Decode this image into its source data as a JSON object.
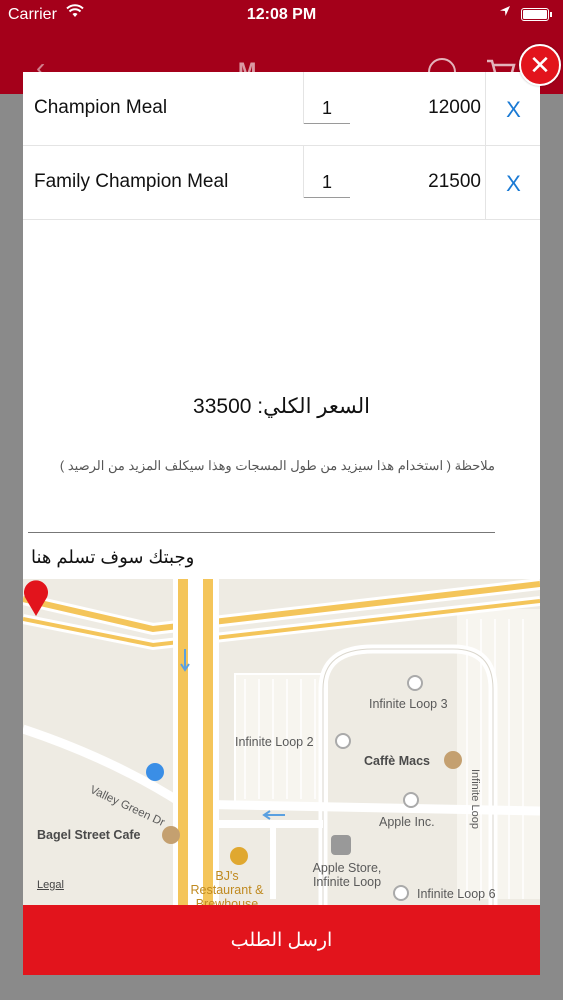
{
  "status_bar": {
    "carrier": "Carrier",
    "time": "12:08 PM"
  },
  "nav": {
    "title": "M..."
  },
  "order_items": [
    {
      "name": "Champion Meal",
      "qty": "1",
      "price": "12000",
      "remove": "X"
    },
    {
      "name": "Family Champion Meal",
      "qty": "1",
      "price": "21500",
      "remove": "X"
    }
  ],
  "total": {
    "label": "السعر الكلي:",
    "value": "33500"
  },
  "note": "ملاحظة ( استخدام هذا سيزيد من طول المسجات وهذا سيكلف المزيد من الرصيد )",
  "deliver_label": "وجبتك سوف تسلم هنا",
  "map": {
    "labels": {
      "infinite_loop_3": "Infinite Loop 3",
      "infinite_loop_2": "Infinite Loop 2",
      "caffe_macs": "Caffè Macs",
      "infinite_loop_road": "Infinite Loop",
      "valley_green": "Valley Green Dr",
      "apple_inc": "Apple Inc.",
      "bagel_street": "Bagel Street Cafe",
      "bjs": "BJ's Restaurant & Brewhouse",
      "apple_store": "Apple Store, Infinite Loop",
      "infinite_loop_6": "Infinite Loop 6"
    },
    "legal": "Legal"
  },
  "submit_label": "ارسل الطلب",
  "icons": [
    "wifi-icon",
    "location-arrow-icon",
    "battery-icon",
    "back-chevron-icon",
    "search-icon",
    "cart-icon",
    "close-icon",
    "map-pin-icon"
  ],
  "colors": {
    "brand_red": "#a4001a",
    "button_red": "#e2141c",
    "link_blue": "#1a7ad4"
  }
}
